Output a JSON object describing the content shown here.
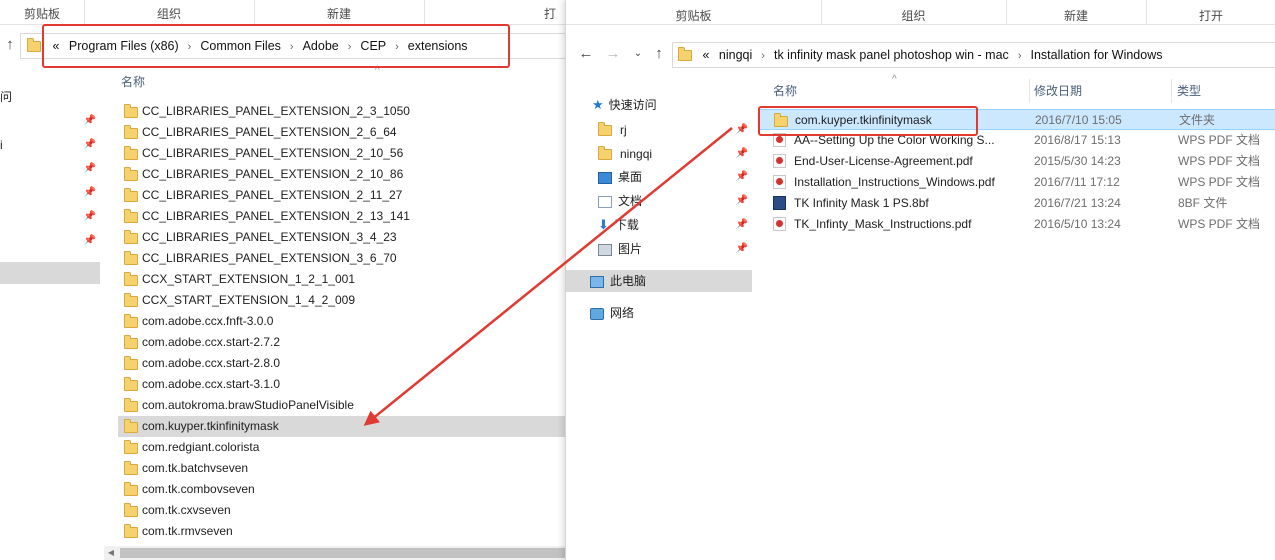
{
  "left_window": {
    "ribbon": {
      "clipboard": "剪贴板",
      "organize": "组织",
      "new": "新建",
      "open": "打开"
    },
    "address": {
      "overflow": "«",
      "crumbs": [
        "Program Files (x86)",
        "Common Files",
        "Adobe",
        "CEP",
        "extensions"
      ]
    },
    "column_name": "名称",
    "nav_fragments": [
      "问",
      "i"
    ],
    "files": [
      "CC_LIBRARIES_PANEL_EXTENSION_2_3_1050",
      "CC_LIBRARIES_PANEL_EXTENSION_2_6_64",
      "CC_LIBRARIES_PANEL_EXTENSION_2_10_56",
      "CC_LIBRARIES_PANEL_EXTENSION_2_10_86",
      "CC_LIBRARIES_PANEL_EXTENSION_2_11_27",
      "CC_LIBRARIES_PANEL_EXTENSION_2_13_141",
      "CC_LIBRARIES_PANEL_EXTENSION_3_4_23",
      "CC_LIBRARIES_PANEL_EXTENSION_3_6_70",
      "CCX_START_EXTENSION_1_2_1_001",
      "CCX_START_EXTENSION_1_4_2_009",
      "com.adobe.ccx.fnft-3.0.0",
      "com.adobe.ccx.start-2.7.2",
      "com.adobe.ccx.start-2.8.0",
      "com.adobe.ccx.start-3.1.0",
      "com.autokroma.brawStudioPanelVisible",
      "com.kuyper.tkinfinitymask",
      "com.redgiant.colorista",
      "com.tk.batchvseven",
      "com.tk.combovseven",
      "com.tk.cxvseven",
      "com.tk.rmvseven"
    ],
    "selected_file": "com.kuyper.tkinfinitymask"
  },
  "right_window": {
    "ribbon": {
      "clipboard": "剪贴板",
      "organize": "组织",
      "new": "新建",
      "open": "打开"
    },
    "address": {
      "overflow": "«",
      "crumbs": [
        "ningqi",
        "tk infinity mask panel photoshop win - mac",
        "Installation for Windows"
      ]
    },
    "columns": {
      "name": "名称",
      "date": "修改日期",
      "type": "类型"
    },
    "nav": {
      "quick_access": "快速访问",
      "items": [
        "rj",
        "ningqi",
        "桌面",
        "文档",
        "下载",
        "图片"
      ],
      "this_pc": "此电脑",
      "network": "网络"
    },
    "files": [
      {
        "name": "com.kuyper.tkinfinitymask",
        "date": "2016/7/10 15:05",
        "type": "文件夹",
        "icon": "folder-icon"
      },
      {
        "name": "AA--Setting Up the Color Working S...",
        "date": "2016/8/17 15:13",
        "type": "WPS PDF 文档",
        "icon": "pdf-icon"
      },
      {
        "name": "End-User-License-Agreement.pdf",
        "date": "2015/5/30 14:23",
        "type": "WPS PDF 文档",
        "icon": "pdf-icon"
      },
      {
        "name": "Installation_Instructions_Windows.pdf",
        "date": "2016/7/11 17:12",
        "type": "WPS PDF 文档",
        "icon": "pdf-icon"
      },
      {
        "name": "TK Infinity Mask 1 PS.8bf",
        "date": "2016/7/21 13:24",
        "type": "8BF 文件",
        "icon": "plugin-file-icon"
      },
      {
        "name": "TK_Infinty_Mask_Instructions.pdf",
        "date": "2016/5/10 13:24",
        "type": "WPS PDF 文档",
        "icon": "pdf-icon"
      }
    ]
  },
  "colors": {
    "annotation_red": "#e03a31",
    "selection_blue": "#cce8ff",
    "selection_gray": "#d9d9d9"
  }
}
